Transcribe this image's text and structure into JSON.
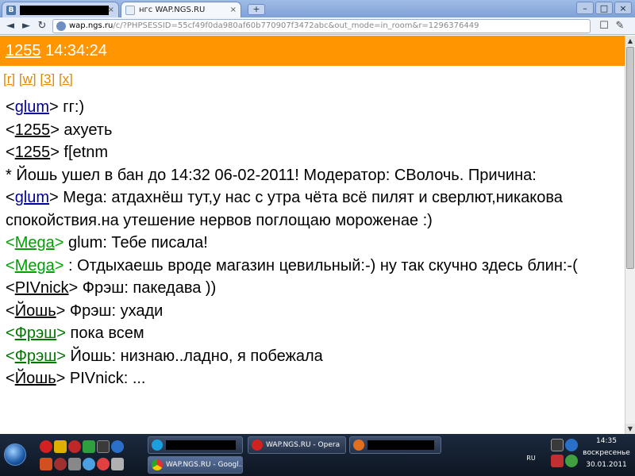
{
  "browser": {
    "tab1_label": "",
    "tab1_favicon": "В",
    "tab2_label": "нгс WAP.NGS.RU",
    "tab_close": "×",
    "new_tab": "+",
    "win_min": "–",
    "win_max": "□",
    "win_close": "×",
    "back": "◄",
    "forward": "►",
    "reload": "↻",
    "url_host": "wap.ngs.ru",
    "url_path": "/c/?PHPSESSID=55cf49f0da980af60b770907f3472abc&out_mode=in_room&r=1296376449",
    "page_icon": "☐",
    "wrench_icon": "✎"
  },
  "chat": {
    "room": "1255",
    "time": "14:34:24",
    "links": [
      "[r]",
      "[w]",
      "[3]",
      "[x]"
    ],
    "messages": [
      {
        "nick": "glum",
        "color": "blue",
        "text": " гг:)"
      },
      {
        "nick": "1255",
        "color": "black",
        "text": " ахуеть"
      },
      {
        "nick": "1255",
        "color": "black",
        "text": " f[etnm"
      },
      {
        "nick": "",
        "color": "",
        "text": "* Йошь ушел в бан до 14:32 06-02-2011! Модератор: СВолочь. Причина:"
      },
      {
        "nick": "glum",
        "color": "blue",
        "text": " Mega: атдахнёш тут,у нас с утра чёта всё пилят и сверлют,никакова спокойствия.на утешение нервов поглощаю мороженае :)"
      },
      {
        "nick": "Mega",
        "color": "green",
        "text": " glum: Тебе писала!"
      },
      {
        "nick": "Mega",
        "color": "green",
        "text": " : Отдыхаешь вроде магазин цевильный:-) ну так скучно здесь блин:-("
      },
      {
        "nick": "PIVnick",
        "color": "black",
        "text": " Фрэш: пакедава ))"
      },
      {
        "nick": "Йошь",
        "color": "black",
        "text": " Фрэш: ухади"
      },
      {
        "nick": "Фрэш",
        "color": "dkgreen",
        "text": " пока всем"
      },
      {
        "nick": "Фрэш",
        "color": "dkgreen",
        "text": " Йошь: низнаю..ладно, я побежала"
      },
      {
        "nick": "Йошь",
        "color": "black",
        "text": " PIVnick: ..."
      }
    ]
  },
  "taskbar": {
    "tasks": [
      {
        "label": ""
      },
      {
        "label": "WAP.NGS.RU - Opera"
      },
      {
        "label": ""
      },
      {
        "label": "WAP.NGS.RU - Googl..."
      }
    ],
    "lang": "RU",
    "time": "14:35",
    "weekday": "воскресенье",
    "date": "30.01.2011"
  },
  "colors": {
    "header_orange": "#ff9500",
    "link_orange": "#e08a00",
    "nick_blue": "#0000a0",
    "nick_green": "#00a000",
    "nick_dark_green": "#007800"
  }
}
